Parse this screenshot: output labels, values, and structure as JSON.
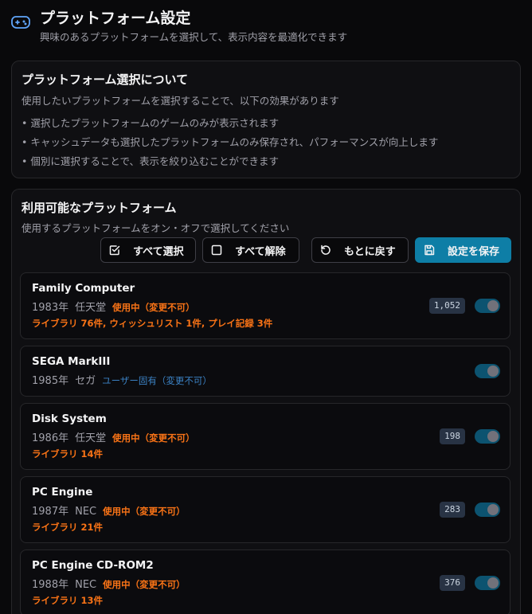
{
  "header": {
    "title": "プラットフォーム設定",
    "subtitle": "興味のあるプラットフォームを選択して、表示内容を最適化できます",
    "icon": "gamepad-icon"
  },
  "about": {
    "title": "プラットフォーム選択について",
    "description": "使用したいプラットフォームを選択することで、以下の効果があります",
    "bullets": [
      "選択したプラットフォームのゲームのみが表示されます",
      "キャッシュデータも選択したプラットフォームのみ保存され、パフォーマンスが向上します",
      "個別に選択することで、表示を絞り込むことができます"
    ]
  },
  "platforms": {
    "title": "利用可能なプラットフォーム",
    "description": "使用するプラットフォームをオン・オフで選択してください",
    "buttons": {
      "select_all": "すべて選択",
      "deselect_all": "すべて解除",
      "reset": "もとに戻す",
      "save": "設定を保存"
    },
    "items": [
      {
        "name": "Family Computer",
        "year": "1983年",
        "maker": "任天堂",
        "status": "使用中（変更不可）",
        "status_type": "active",
        "usage": "ライブラリ 76件, ウィッシュリスト 1件, プレイ記録 3件",
        "count": "1,052",
        "enabled": true
      },
      {
        "name": "SEGA MarkIII",
        "year": "1985年",
        "maker": "セガ",
        "status": "ユーザー固有（変更不可）",
        "status_type": "user",
        "usage": "",
        "count": "",
        "enabled": true
      },
      {
        "name": "Disk System",
        "year": "1986年",
        "maker": "任天堂",
        "status": "使用中（変更不可）",
        "status_type": "active",
        "usage": "ライブラリ 14件",
        "count": "198",
        "enabled": true
      },
      {
        "name": "PC Engine",
        "year": "1987年",
        "maker": "NEC",
        "status": "使用中（変更不可）",
        "status_type": "active",
        "usage": "ライブラリ 21件",
        "count": "283",
        "enabled": true
      },
      {
        "name": "PC Engine CD-ROM2",
        "year": "1988年",
        "maker": "NEC",
        "status": "使用中（変更不可）",
        "status_type": "active",
        "usage": "ライブラリ 13件",
        "count": "376",
        "enabled": true
      }
    ]
  },
  "colors": {
    "background": "#09090b",
    "accent": "#0e7ea6",
    "active_status": "#f97316",
    "user_status": "#3b82c4",
    "toggle_on": "#0c5370"
  }
}
